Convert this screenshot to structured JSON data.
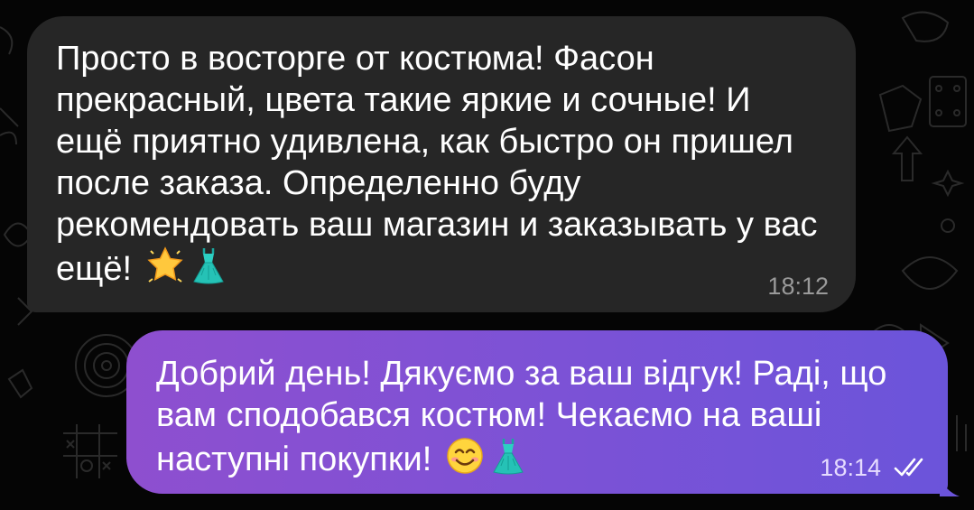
{
  "messages": [
    {
      "direction": "incoming",
      "text": "Просто в восторге от костюма! Фасон прекрасный, цвета такие яркие и сочные! И ещё приятно удивлена, как быстро он пришел после заказа. Определенно буду рекомендовать ваш магазин и заказывать у вас ещё!",
      "emojis": [
        "glowing-star",
        "dress"
      ],
      "time": "18:12"
    },
    {
      "direction": "outgoing",
      "text": "Добрий день! Дякуємо за ваш відгук! Раді, що вам сподобався костюм! Чекаємо на ваші наступні покупки!",
      "emojis": [
        "smiling-face",
        "dress"
      ],
      "time": "18:14",
      "status": "read-double-check"
    }
  ],
  "colors": {
    "background": "#050505",
    "incoming_bubble": "#262626",
    "outgoing_gradient_start": "#8e4fcf",
    "outgoing_gradient_end": "#6b54da",
    "incoming_time": "#9a9a9a"
  }
}
